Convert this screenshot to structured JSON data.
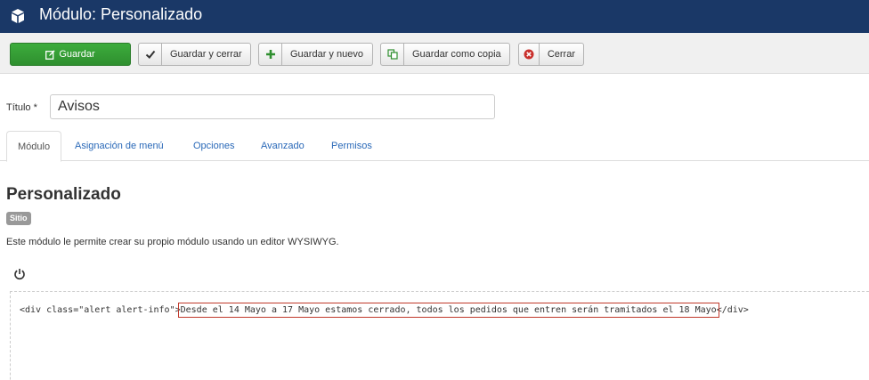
{
  "header": {
    "title": "Módulo: Personalizado",
    "icon": "cube-icon"
  },
  "toolbar": {
    "save_label": "Guardar",
    "save_close_label": "Guardar y cerrar",
    "save_new_label": "Guardar y nuevo",
    "save_copy_label": "Guardar como copia",
    "close_label": "Cerrar",
    "colors": {
      "save": "#2f8f2f",
      "close_icon": "#c9302c"
    }
  },
  "form": {
    "title_label": "Título *",
    "title_value": "Avisos"
  },
  "tabs": [
    {
      "label": "Módulo",
      "active": true
    },
    {
      "label": "Asignación de menú",
      "active": false
    },
    {
      "label": "Opciones",
      "active": false
    },
    {
      "label": "Avanzado",
      "active": false
    },
    {
      "label": "Permisos",
      "active": false
    }
  ],
  "module": {
    "name": "Personalizado",
    "badge": "Sitio",
    "description": "Este módulo le permite crear su propio módulo usando un editor WYSIWYG."
  },
  "editor": {
    "code_open": "<div class=\"alert alert-info\">",
    "code_selected": "Desde el 14 Mayo a 17 Mayo estamos cerrado, todos los pedidos que entren serán tramitados el 18 Mayo",
    "code_close": "</div>"
  }
}
